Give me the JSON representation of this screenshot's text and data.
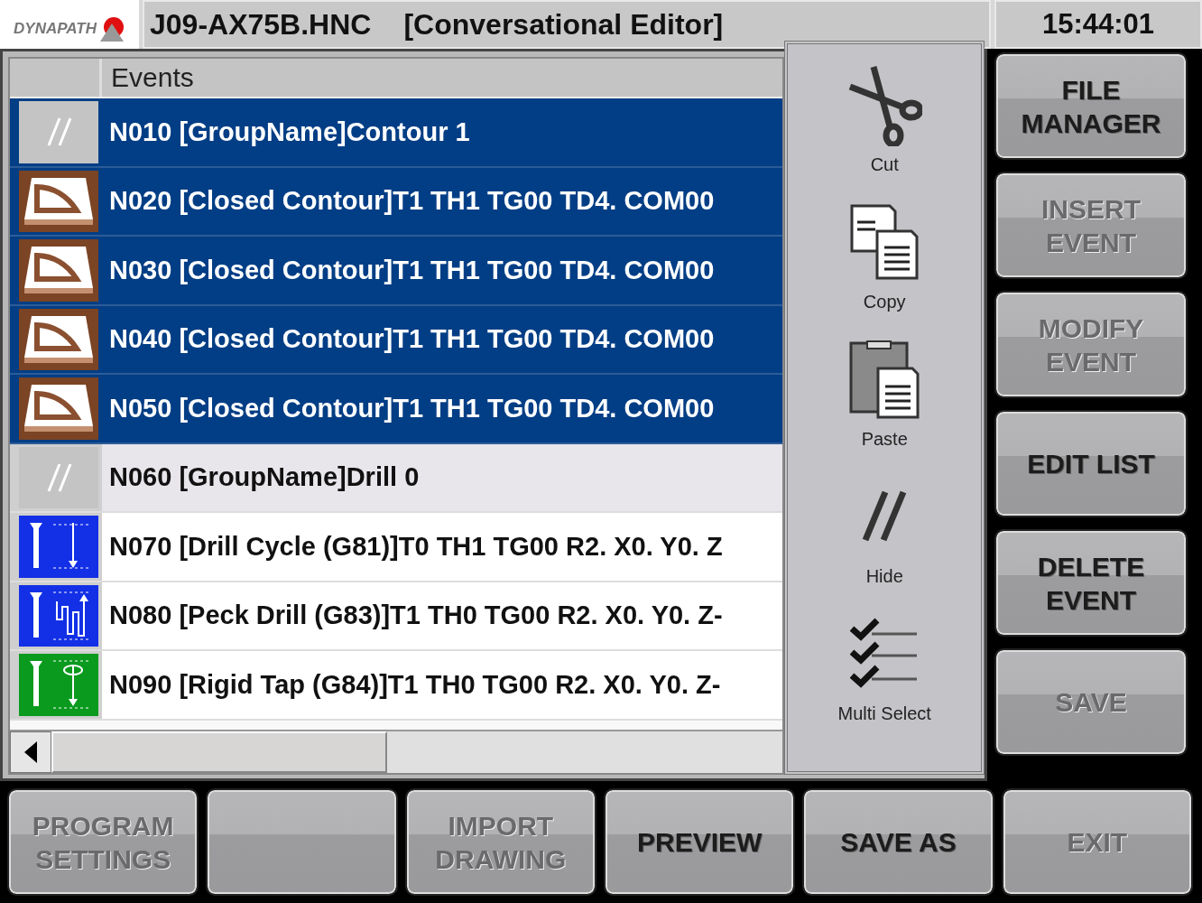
{
  "header": {
    "logo_text": "DYNAPATH",
    "file": "J09-AX75B.HNC",
    "mode": "[Conversational Editor]",
    "clock": "15:44:01"
  },
  "events": {
    "column": "Events",
    "rows": [
      {
        "kind": "group",
        "text": "N010 [GroupName]Contour 1",
        "selected": true
      },
      {
        "kind": "contour",
        "text": "N020 [Closed Contour]T1 TH1 TG00 TD4. COM00",
        "selected": true
      },
      {
        "kind": "contour",
        "text": "N030 [Closed Contour]T1 TH1 TG00 TD4. COM00",
        "selected": true
      },
      {
        "kind": "contour",
        "text": "N040 [Closed Contour]T1 TH1 TG00 TD4. COM00",
        "selected": true
      },
      {
        "kind": "contour",
        "text": "N050 [Closed Contour]T1 TH1 TG00 TD4. COM00",
        "selected": true
      },
      {
        "kind": "group",
        "text": "N060 [GroupName]Drill 0",
        "selected": false
      },
      {
        "kind": "drill",
        "text": "N070 [Drill Cycle (G81)]T0 TH1 TG00 R2. X0. Y0. Z",
        "selected": false
      },
      {
        "kind": "peck",
        "text": "N080 [Peck Drill (G83)]T1 TH0 TG00 R2. X0. Y0. Z-",
        "selected": false
      },
      {
        "kind": "tap",
        "text": "N090 [Rigid Tap (G84)]T1 TH0 TG00 R2. X0. Y0. Z-",
        "selected": false
      }
    ]
  },
  "edit_menu": [
    {
      "kind": "cut",
      "label": "Cut"
    },
    {
      "kind": "copy",
      "label": "Copy"
    },
    {
      "kind": "paste",
      "label": "Paste"
    },
    {
      "kind": "hide",
      "label": "Hide"
    },
    {
      "kind": "multi_select",
      "label": "Multi Select"
    }
  ],
  "side_buttons": [
    {
      "lines": [
        "FILE",
        "MANAGER"
      ],
      "disabled": false
    },
    {
      "lines": [
        "INSERT",
        "EVENT"
      ],
      "disabled": true
    },
    {
      "lines": [
        "MODIFY",
        "EVENT"
      ],
      "disabled": true
    },
    {
      "lines": [
        "EDIT LIST"
      ],
      "disabled": false
    },
    {
      "lines": [
        "DELETE",
        "EVENT"
      ],
      "disabled": false
    },
    {
      "lines": [
        "SAVE"
      ],
      "disabled": true
    }
  ],
  "bottom_buttons": [
    {
      "lines": [
        "PROGRAM",
        "SETTINGS"
      ],
      "disabled": true
    },
    {
      "kind": "blank"
    },
    {
      "lines": [
        "IMPORT",
        "DRAWING"
      ],
      "disabled": true
    },
    {
      "lines": [
        "PREVIEW"
      ],
      "disabled": false
    },
    {
      "lines": [
        "SAVE AS"
      ],
      "disabled": false
    },
    {
      "lines": [
        "EXIT"
      ],
      "disabled": true
    }
  ]
}
